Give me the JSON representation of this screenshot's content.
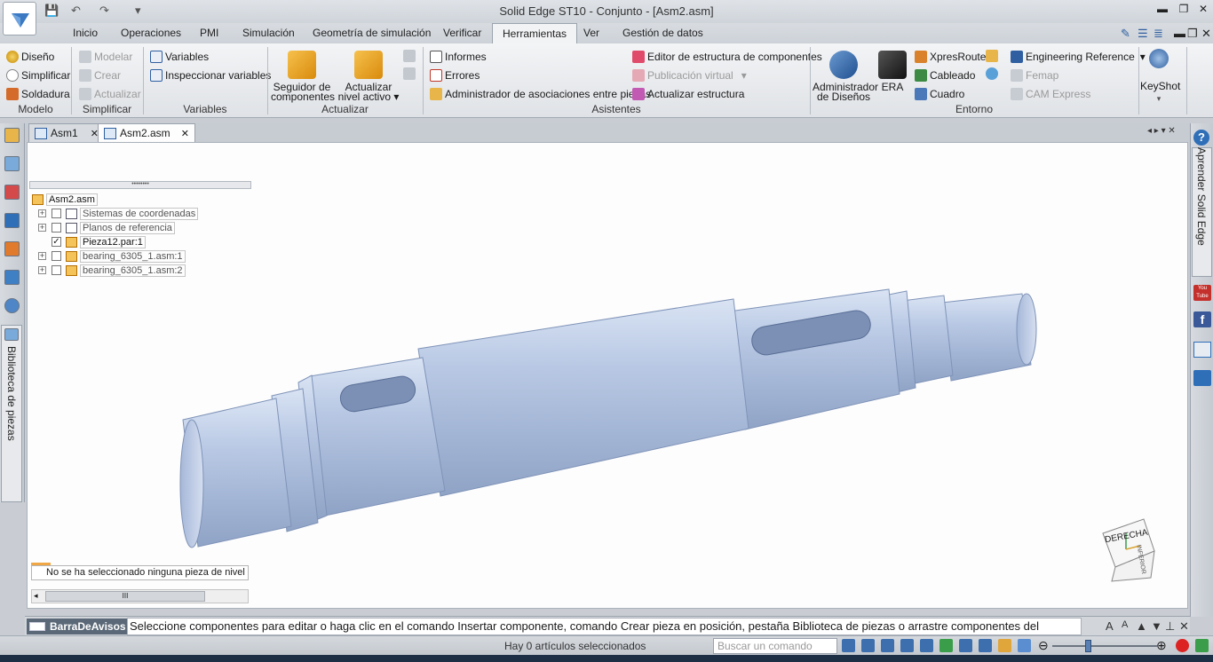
{
  "titlebar": {
    "title": "Solid Edge ST10 - Conjunto - [Asm2.asm]",
    "minimize": "▬",
    "restore": "❐",
    "close": "✕",
    "qat_save": "💾",
    "qat_undo": "↶",
    "qat_redo": "↷",
    "qat_more": "▾"
  },
  "ribbon_tabs": [
    "Inicio",
    "Operaciones",
    "PMI",
    "Simulación",
    "Geometría de simulación",
    "Verificar",
    "Herramientas",
    "Ver",
    "Gestión de datos"
  ],
  "ribbon_tabs_active": "Herramientas",
  "ribbon": {
    "modelo": {
      "label": "Modelo",
      "diseno": "Diseño",
      "simplificar": "Simplificar",
      "soldadura": "Soldadura"
    },
    "simplificar": {
      "label": "Simplificar",
      "modelar": "Modelar",
      "crear": "Crear",
      "actualizar": "Actualizar"
    },
    "variables": {
      "label": "Variables",
      "variables": "Variables",
      "inspeccionar": "Inspeccionar variables"
    },
    "actualizar": {
      "label": "Actualizar",
      "seguidor_1": "Seguidor de",
      "seguidor_2": "componentes",
      "nivel_1": "Actualizar",
      "nivel_2": "nivel activo ▾"
    },
    "asistentes": {
      "label": "Asistentes",
      "informes": "Informes",
      "errores": "Errores",
      "administrador_asoc": "Administrador de asociaciones entre piezas",
      "editor_estructura": "Editor de estructura de componentes",
      "publicacion_virtual": "Publicación virtual",
      "actualizar_estructura": "Actualizar estructura"
    },
    "entorno": {
      "label": "Entorno",
      "admin_1": "Administrador",
      "admin_2": "de Diseños",
      "era": "ERA",
      "xpresroute": "XpresRoute",
      "cableado": "Cableado",
      "cuadro": "Cuadro",
      "engineering_reference": "Engineering Reference",
      "femap": "Femap",
      "cam_express": "CAM Express"
    },
    "keyshot": {
      "label": "KeyShot"
    }
  },
  "doc_tabs": [
    {
      "label": "Asm1",
      "close": "✕"
    },
    {
      "label": "Asm2.asm",
      "close": "✕"
    }
  ],
  "tree": {
    "handle": "••••••••",
    "root": "Asm2.asm",
    "rows": [
      {
        "label": "Sistemas de coordenadas",
        "checked": false,
        "expand": "+"
      },
      {
        "label": "Planos de referencia",
        "checked": false,
        "expand": "+"
      },
      {
        "label": "Pieza12.par:1",
        "checked": true,
        "expand": ""
      },
      {
        "label": "bearing_6305_1.asm:1",
        "checked": false,
        "expand": "+"
      },
      {
        "label": "bearing_6305_1.asm:2",
        "checked": false,
        "expand": "+"
      }
    ],
    "status": "No se ha seleccionado ninguna pieza de nivel su",
    "scroll_grip": "III"
  },
  "view_cube": {
    "face_front": "DERECHA",
    "face_side": "INFERIOR"
  },
  "left_panel": {
    "library_label": "Biblioteca de piezas"
  },
  "right_panel": {
    "learn_label": "Aprender Solid Edge",
    "youtube": "You Tube",
    "facebook": "f"
  },
  "promptbar": {
    "title": "BarraDeAvisos",
    "text": "Seleccione componentes para editar o haga clic en el comando Insertar componente, comando Crear pieza en posición, pestaña Biblioteca de piezas o arrastre componentes del"
  },
  "statusbar": {
    "selection": "Hay 0 artículos seleccionados",
    "search_placeholder": "Buscar un comando"
  },
  "colors": {
    "model_body": "#b9c8e3",
    "model_shadow": "#8fa3c6",
    "ribbon_bg": "#e9ebee",
    "prompt_title_bg": "#5a6877",
    "accent": "#2f5fa0"
  }
}
